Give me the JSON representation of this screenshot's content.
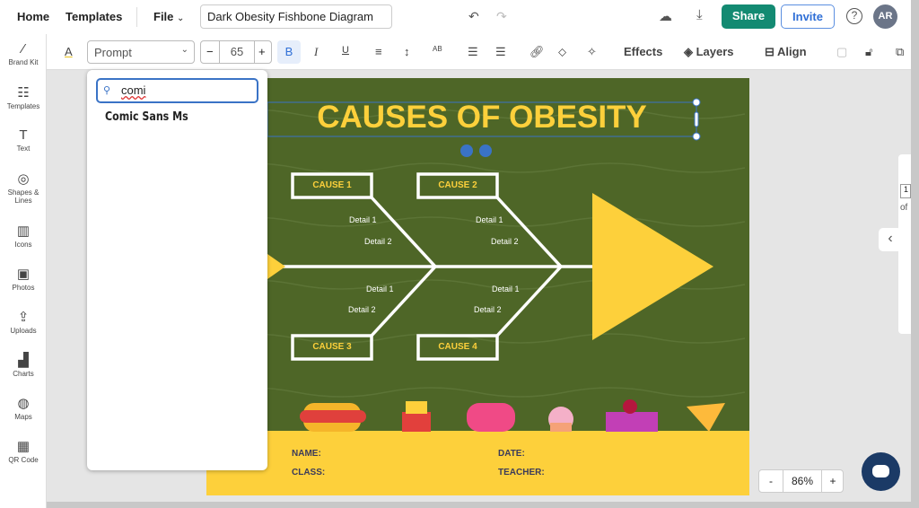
{
  "header": {
    "home": "Home",
    "templates": "Templates",
    "file": "File",
    "doc_title": "Dark Obesity Fishbone Diagram",
    "share": "Share",
    "invite": "Invite",
    "avatar": "AR",
    "accent": "#138a72"
  },
  "sidebar": {
    "items": [
      {
        "label": "Brand Kit",
        "icon": "magic-wand-icon"
      },
      {
        "label": "Templates",
        "icon": "templates-icon"
      },
      {
        "label": "Text",
        "icon": "text-icon"
      },
      {
        "label": "Shapes & Lines",
        "icon": "shapes-icon"
      },
      {
        "label": "Icons",
        "icon": "icons-icon"
      },
      {
        "label": "Photos",
        "icon": "photo-icon"
      },
      {
        "label": "Uploads",
        "icon": "upload-icon"
      },
      {
        "label": "Charts",
        "icon": "chart-icon"
      },
      {
        "label": "Maps",
        "icon": "globe-icon"
      },
      {
        "label": "QR Code",
        "icon": "qr-icon"
      }
    ]
  },
  "toolbar": {
    "font": "Prompt",
    "font_size": "65",
    "effects": "Effects",
    "layers": "Layers",
    "align": "Align"
  },
  "font_panel": {
    "search_value": "comi",
    "results": [
      "Comic Sans Ms"
    ]
  },
  "canvas": {
    "title": "CAUSES OF OBESITY",
    "causes": [
      "CAUSE 1",
      "CAUSE 2",
      "CAUSE 3",
      "CAUSE 4"
    ],
    "detail1": "Detail 1",
    "detail2": "Detail 2",
    "footer": {
      "name": "NAME:",
      "class": "CLASS:",
      "date": "DATE:",
      "teacher": "TEACHER:"
    },
    "bg": "#4e6627",
    "yellow": "#fdd03b"
  },
  "zoom": {
    "value": "86%",
    "minus": "-",
    "plus": "+"
  },
  "pages": {
    "of": "of",
    "page": "1"
  }
}
